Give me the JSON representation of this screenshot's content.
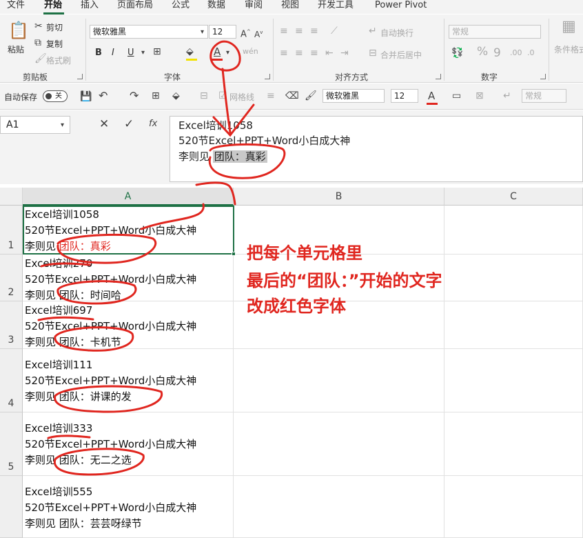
{
  "menu": {
    "items": [
      "文件",
      "开始",
      "插入",
      "页面布局",
      "公式",
      "数据",
      "审阅",
      "视图",
      "开发工具",
      "Power Pivot"
    ],
    "active_index": 1
  },
  "ribbon": {
    "clipboard": {
      "paste": "粘贴",
      "cut": "剪切",
      "copy": "复制",
      "format_painter": "格式刷",
      "label": "剪贴板"
    },
    "font": {
      "name": "微软雅黑",
      "size": "12",
      "bold": "B",
      "italic": "I",
      "underline": "U",
      "label": "字体"
    },
    "alignment": {
      "wrap_text": "自动换行",
      "merge": "合并后居中",
      "label": "对齐方式"
    },
    "number": {
      "format": "常规",
      "label": "数字"
    },
    "styles": {
      "conditional": "条件格式"
    }
  },
  "qat": {
    "autosave": "自动保存",
    "autosave_state": "关",
    "gridlines": "网格线",
    "font_name": "微软雅黑",
    "font_size": "12",
    "number_format": "常规"
  },
  "formula_bar": {
    "name_box": "A1",
    "fx_icon": "fx",
    "content_lines": [
      "Excel培训1058",
      "520节Excel+PPT+Word小白成大神",
      "李则见 团队：真彩"
    ]
  },
  "sheet": {
    "columns": [
      "A",
      "B",
      "C"
    ],
    "rows": [
      {
        "num": "1",
        "lines": [
          "Excel培训1058",
          "520节Excel+PPT+Word小白成大神"
        ],
        "prefix": "李则见 ",
        "team": "团队：真彩",
        "team_red": true
      },
      {
        "num": "2",
        "lines": [
          "Excel培训270",
          "520节Excel+PPT+Word小白成大神"
        ],
        "prefix": "李则见 ",
        "team": "团队：时间哈",
        "team_red": false
      },
      {
        "num": "3",
        "lines": [
          "Excel培训697",
          "520节Excel+PPT+Word小白成大神"
        ],
        "prefix": "李则见 ",
        "team": "团队：卡机节",
        "team_red": false
      },
      {
        "num": "4",
        "lines": [
          "Excel培训111",
          "520节Excel+PPT+Word小白成大神"
        ],
        "prefix": "李则见 ",
        "team": "团队：讲课的发",
        "team_red": false
      },
      {
        "num": "5",
        "lines": [
          "Excel培训333",
          "520节Excel+PPT+Word小白成大神"
        ],
        "prefix": "李则见 ",
        "team": "团队：无二之选",
        "team_red": false
      },
      {
        "num": "",
        "lines": [
          "Excel培训555",
          "520节Excel+PPT+Word小白成大神"
        ],
        "prefix": "李则见 ",
        "team": "团队：芸芸呀绿节",
        "team_red": false
      }
    ]
  },
  "annotation": {
    "lines": [
      "把每个单元格里",
      "最后的“团队：”开始的文字",
      "改成红色字体"
    ],
    "color": "#e0261f"
  },
  "colors": {
    "accent": "#1e7145",
    "annotation_red": "#e0261f"
  }
}
